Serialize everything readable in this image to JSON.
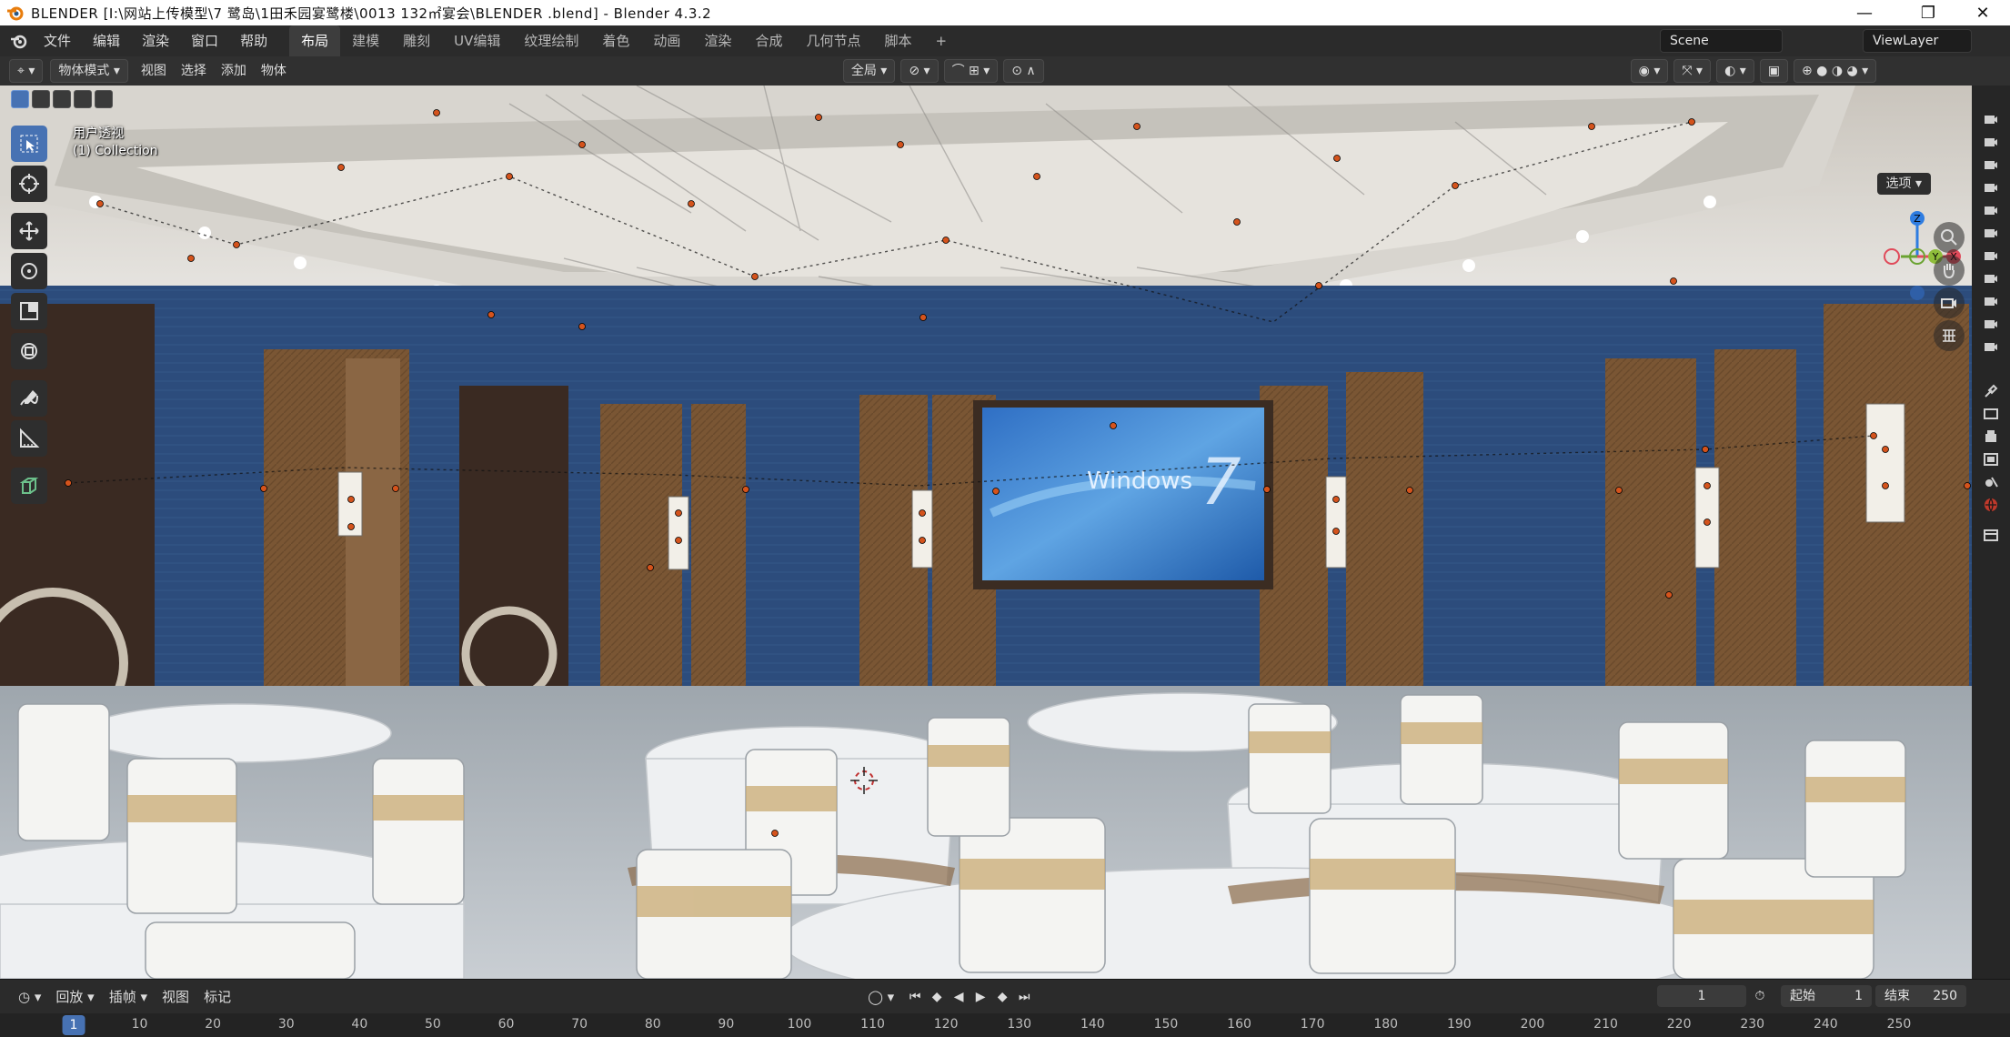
{
  "window": {
    "title": "BLENDER  [I:\\网站上传模型\\7 鹭岛\\1田禾园宴鹭楼\\0013 132㎡宴会\\BLENDER .blend] - Blender 4.3.2"
  },
  "menu": {
    "items": [
      "文件",
      "编辑",
      "渲染",
      "窗口",
      "帮助"
    ]
  },
  "workspaces": {
    "tabs": [
      "布局",
      "建模",
      "雕刻",
      "UV编辑",
      "纹理绘制",
      "着色",
      "动画",
      "渲染",
      "合成",
      "几何节点",
      "脚本"
    ],
    "active": "布局",
    "add": "+"
  },
  "scene": {
    "name": "Scene",
    "view_layer": "ViewLayer"
  },
  "viewport_header": {
    "mode": "物体模式",
    "menus": [
      "视图",
      "选择",
      "添加",
      "物体"
    ],
    "orientation": "全局",
    "options": "选项"
  },
  "viewport": {
    "view_name": "用户透视",
    "collection": "(1) Collection",
    "tv_text": "Windows",
    "tv_number": "7",
    "axes": {
      "x": "X",
      "y": "Y",
      "z": "Z"
    }
  },
  "timeline": {
    "playback": "回放",
    "keying": "插帧",
    "view": "视图",
    "marker": "标记",
    "current_frame": 1,
    "start_label": "起始",
    "start": 1,
    "end_label": "结束",
    "end": 250,
    "ruler": [
      1,
      10,
      20,
      30,
      40,
      50,
      60,
      70,
      80,
      90,
      100,
      110,
      120,
      130,
      140,
      150,
      160,
      170,
      180,
      190,
      200,
      210,
      220,
      230,
      240,
      250
    ]
  },
  "colors": {
    "accent": "#4772b3",
    "header": "#303030",
    "wall_blue": "#2c4c7c",
    "wood": "#7a5634"
  },
  "icons": [
    "blender-logo-icon",
    "minimize-icon",
    "maximize-icon",
    "close-icon",
    "cursor-icon",
    "move-icon",
    "rotate-icon",
    "scale-icon",
    "transform-icon",
    "annotate-icon",
    "measure-icon",
    "add-cube-icon",
    "zoom-icon",
    "hand-icon",
    "camera-icon",
    "grid-icon"
  ]
}
